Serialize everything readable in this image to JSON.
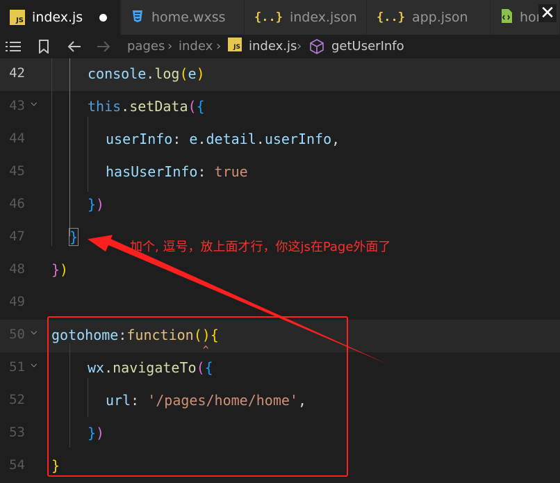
{
  "tabs": [
    {
      "label": "index.js",
      "icon": "js-file-icon",
      "active": true,
      "dirty": true
    },
    {
      "label": "home.wxss",
      "icon": "css-file-icon",
      "active": false
    },
    {
      "label": "index.json",
      "icon": "json-file-icon",
      "active": false
    },
    {
      "label": "app.json",
      "icon": "json-file-icon",
      "active": false
    },
    {
      "label": "home",
      "icon": "wxml-file-icon",
      "active": false
    }
  ],
  "window": {
    "close_glyph": "✕"
  },
  "breadcrumb": [
    "pages",
    "index",
    "index.js",
    "getUserInfo"
  ],
  "icons": {
    "js_badge": "JS",
    "json_badge": "{..}"
  },
  "lines": [
    {
      "n": "42"
    },
    {
      "n": "43"
    },
    {
      "n": "44"
    },
    {
      "n": "45"
    },
    {
      "n": "46"
    },
    {
      "n": "47"
    },
    {
      "n": "48"
    },
    {
      "n": "49"
    },
    {
      "n": "50"
    },
    {
      "n": "51"
    },
    {
      "n": "52"
    },
    {
      "n": "53"
    },
    {
      "n": "54"
    }
  ],
  "annotation": "加个, 逗号，放上面才行，你这js在Page外面了",
  "colors": {
    "annotation": "#ff2d2d",
    "keyword": "#569cd6",
    "function": "#dcdcaa",
    "string": "#ce9178",
    "bracket_gold": "#ffd700",
    "bracket_purple": "#da70d6",
    "bracket_blue": "#179fff"
  }
}
